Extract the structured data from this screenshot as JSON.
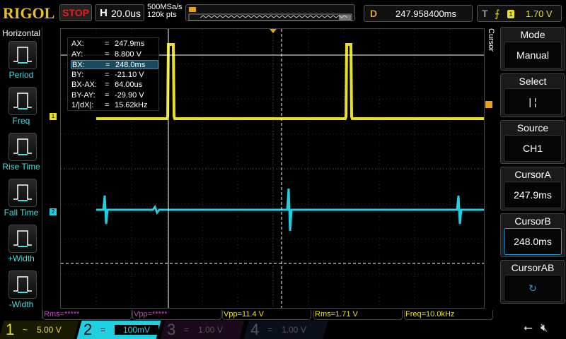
{
  "header": {
    "logo": "RIGOL",
    "run_state": "STOP",
    "h_label": "H",
    "timebase": "20.0us",
    "sample_rate": "500MSa/s",
    "mem_depth": "120k pts",
    "d_label": "D",
    "delay": "247.958400ms",
    "t_label": "T",
    "trigger_source": "1",
    "trigger_level": "1.70 V"
  },
  "left_panel": {
    "title": "Horizontal",
    "items": [
      {
        "label": "Period",
        "icon": "period-icon"
      },
      {
        "label": "Freq",
        "icon": "freq-icon"
      },
      {
        "label": "Rise Time",
        "icon": "rise-time-icon"
      },
      {
        "label": "Fall Time",
        "icon": "fall-time-icon"
      },
      {
        "label": "+Width",
        "icon": "pos-width-icon"
      },
      {
        "label": "-Width",
        "icon": "neg-width-icon"
      }
    ]
  },
  "cursor_info": [
    {
      "k": "AX:",
      "v": "247.9ms"
    },
    {
      "k": "AY:",
      "v": "8.800 V"
    },
    {
      "k": "BX:",
      "v": "248.0ms"
    },
    {
      "k": "BY:",
      "v": "-21.10 V"
    },
    {
      "k": "BX-AX:",
      "v": "64.00us"
    },
    {
      "k": "BY-AY:",
      "v": "-29.90 V"
    },
    {
      "k": "1/|dX|:",
      "v": "15.62kHz"
    }
  ],
  "cursor_eq": "=",
  "right_panel": {
    "vertical_label": "Cursor",
    "mode": {
      "title": "Mode",
      "value": "Manual"
    },
    "select": {
      "title": "Select",
      "value": "|  ¦"
    },
    "source": {
      "title": "Source",
      "value": "CH1"
    },
    "cursor_a": {
      "title": "CursorA",
      "value": "247.9ms"
    },
    "cursor_b": {
      "title": "CursorB",
      "value": "248.0ms"
    },
    "cursor_ab": {
      "title": "CursorAB",
      "value": "↻"
    }
  },
  "measurements": [
    "Rms=*****",
    "Vpp=*****",
    "Vpp=11.4 V",
    "Rms=1.71 V",
    "Freq=10.0kHz"
  ],
  "channels": [
    {
      "num": "1",
      "coupling": "~",
      "scale": "5.00 V",
      "color": "#e8e020"
    },
    {
      "num": "2",
      "coupling": "=",
      "scale": "100mV",
      "color": "#20d0e0"
    },
    {
      "num": "3",
      "coupling": "=",
      "scale": "1.00 V",
      "color": "#c020c0"
    },
    {
      "num": "4",
      "coupling": "=",
      "scale": "1.00 V",
      "color": "#2060c0"
    }
  ],
  "markers": {
    "ch1": "1",
    "ch2": "2"
  },
  "status_icons": [
    "usb-icon",
    "speaker-muted-icon"
  ]
}
